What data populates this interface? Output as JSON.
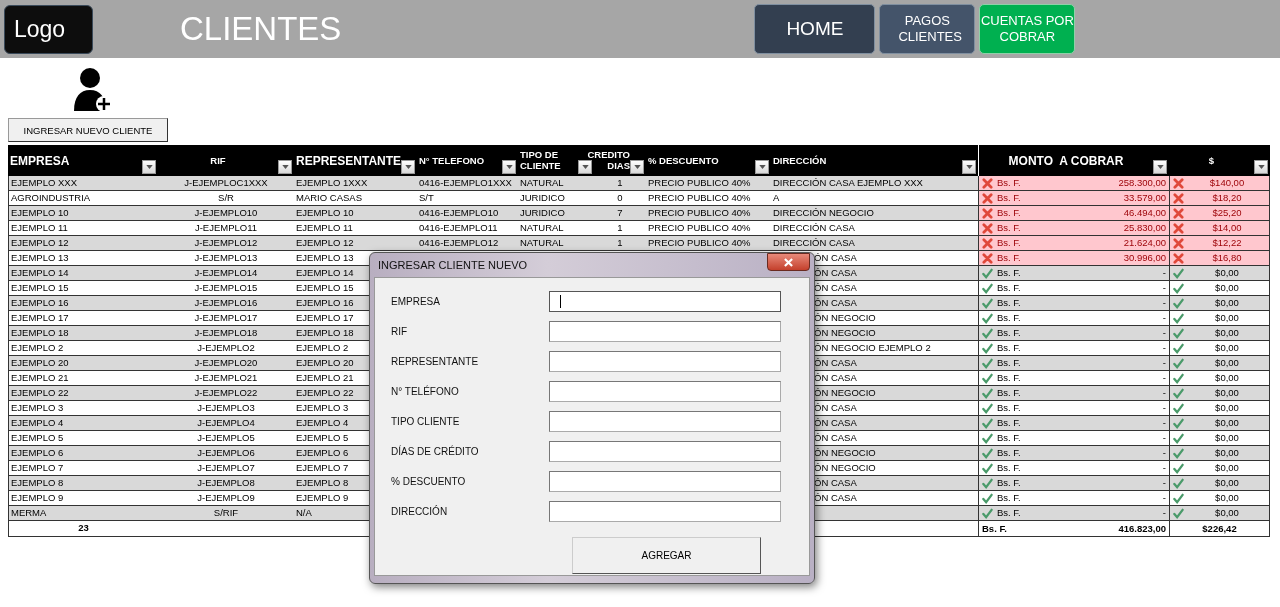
{
  "header": {
    "logo": "Logo",
    "title": "CLIENTES",
    "nav": [
      {
        "label": "HOME",
        "kind": "dark"
      },
      {
        "label": "PAGOS CLIENTES",
        "kind": "slate"
      },
      {
        "label": "CUENTAS POR COBRAR",
        "kind": "green"
      }
    ]
  },
  "new_client_button": "INGRESAR NUEVO CLIENTE",
  "table": {
    "columns": [
      {
        "label": "EMPRESA"
      },
      {
        "label": "RIF"
      },
      {
        "label": "REPRESENTANTE"
      },
      {
        "label": "N° TELEFONO"
      },
      {
        "label": "TIPO DE CLIENTE"
      },
      {
        "label": "CREDITO DIAS"
      },
      {
        "label": "% DESCUENTO"
      },
      {
        "label": "DIRECCIÓN"
      },
      {
        "label": "MONTO  A COBRAR"
      },
      {
        "label": "$"
      }
    ],
    "rows": [
      {
        "empresa": "EJEMPLO XXX",
        "rif": "J-EJEMPLOC1XXX",
        "representante": "EJEMPLO 1XXX",
        "telefono": "0416-EJEMPLO1XXX",
        "tipo": "NATURAL",
        "credito": "1",
        "descuento": "PRECIO PUBLICO 40%",
        "direccion": "DIRECCIÓN CASA EJEMPLO XXX",
        "covered": false,
        "pending": true,
        "currency": "Bs. F.",
        "monto": "258.300,00",
        "usd": "$140,00"
      },
      {
        "empresa": "AGROINDUSTRIA",
        "rif": "S/R",
        "representante": "MARIO CASAS",
        "telefono": "S/T",
        "tipo": "JURIDICO",
        "credito": "0",
        "descuento": "PRECIO PUBLICO 40%",
        "direccion": "A",
        "covered": false,
        "pending": true,
        "currency": "Bs. F.",
        "monto": "33.579,00",
        "usd": "$18,20"
      },
      {
        "empresa": "EJEMPLO 10",
        "rif": "J-EJEMPLO10",
        "representante": "EJEMPLO 10",
        "telefono": "0416-EJEMPLO10",
        "tipo": "JURIDICO",
        "credito": "7",
        "descuento": "PRECIO PUBLICO 40%",
        "direccion": "DIRECCIÓN NEGOCIO",
        "covered": false,
        "pending": true,
        "currency": "Bs. F.",
        "monto": "46.494,00",
        "usd": "$25,20"
      },
      {
        "empresa": "EJEMPLO 11",
        "rif": "J-EJEMPLO11",
        "representante": "EJEMPLO 11",
        "telefono": "0416-EJEMPLO11",
        "tipo": "NATURAL",
        "credito": "1",
        "descuento": "PRECIO PUBLICO 40%",
        "direccion": "DIRECCIÓN CASA",
        "covered": false,
        "pending": true,
        "currency": "Bs. F.",
        "monto": "25.830,00",
        "usd": "$14,00"
      },
      {
        "empresa": "EJEMPLO 12",
        "rif": "J-EJEMPLO12",
        "representante": "EJEMPLO 12",
        "telefono": "0416-EJEMPLO12",
        "tipo": "NATURAL",
        "credito": "1",
        "descuento": "PRECIO PUBLICO 40%",
        "direccion": "DIRECCIÓN CASA",
        "covered": false,
        "pending": true,
        "currency": "Bs. F.",
        "monto": "21.624,00",
        "usd": "$12,22"
      },
      {
        "empresa": "EJEMPLO 13",
        "rif": "J-EJEMPLO13",
        "representante": "EJEMPLO 13",
        "direccion": "ÓN CASA",
        "covered": true,
        "pending": true,
        "currency": "Bs. F.",
        "monto": "30.996,00",
        "usd": "$16,80"
      },
      {
        "empresa": "EJEMPLO 14",
        "rif": "J-EJEMPLO14",
        "representante": "EJEMPLO 14",
        "direccion": "ÓN CASA",
        "covered": true,
        "pending": false,
        "currency": "Bs. F.",
        "monto": "-",
        "usd": "$0,00"
      },
      {
        "empresa": "EJEMPLO 15",
        "rif": "J-EJEMPLO15",
        "representante": "EJEMPLO 15",
        "direccion": "ÓN CASA",
        "covered": true,
        "pending": false,
        "currency": "Bs. F.",
        "monto": "-",
        "usd": "$0,00"
      },
      {
        "empresa": "EJEMPLO 16",
        "rif": "J-EJEMPLO16",
        "representante": "EJEMPLO 16",
        "direccion": "ÓN CASA",
        "covered": true,
        "pending": false,
        "currency": "Bs. F.",
        "monto": "-",
        "usd": "$0,00"
      },
      {
        "empresa": "EJEMPLO 17",
        "rif": "J-EJEMPLO17",
        "representante": "EJEMPLO 17",
        "direccion": "ÓN NEGOCIO",
        "covered": true,
        "pending": false,
        "currency": "Bs. F.",
        "monto": "-",
        "usd": "$0,00"
      },
      {
        "empresa": "EJEMPLO 18",
        "rif": "J-EJEMPLO18",
        "representante": "EJEMPLO 18",
        "direccion": "ÓN NEGOCIO",
        "covered": true,
        "pending": false,
        "currency": "Bs. F.",
        "monto": "-",
        "usd": "$0,00"
      },
      {
        "empresa": "EJEMPLO 2",
        "rif": "J-EJEMPLO2",
        "representante": "EJEMPLO 2",
        "direccion": "ÓN NEGOCIO EJEMPLO 2",
        "covered": true,
        "pending": false,
        "currency": "Bs. F.",
        "monto": "-",
        "usd": "$0,00"
      },
      {
        "empresa": "EJEMPLO 20",
        "rif": "J-EJEMPLO20",
        "representante": "EJEMPLO 20",
        "direccion": "ÓN CASA",
        "covered": true,
        "pending": false,
        "currency": "Bs. F.",
        "monto": "-",
        "usd": "$0,00"
      },
      {
        "empresa": "EJEMPLO 21",
        "rif": "J-EJEMPLO21",
        "representante": "EJEMPLO 21",
        "direccion": "ÓN CASA",
        "covered": true,
        "pending": false,
        "currency": "Bs. F.",
        "monto": "-",
        "usd": "$0,00"
      },
      {
        "empresa": "EJEMPLO 22",
        "rif": "J-EJEMPLO22",
        "representante": "EJEMPLO 22",
        "direccion": "ÓN NEGOCIO",
        "covered": true,
        "pending": false,
        "currency": "Bs. F.",
        "monto": "-",
        "usd": "$0,00"
      },
      {
        "empresa": "EJEMPLO 3",
        "rif": "J-EJEMPLO3",
        "representante": "EJEMPLO 3",
        "direccion": "ÓN CASA",
        "covered": true,
        "pending": false,
        "currency": "Bs. F.",
        "monto": "-",
        "usd": "$0,00"
      },
      {
        "empresa": "EJEMPLO 4",
        "rif": "J-EJEMPLO4",
        "representante": "EJEMPLO 4",
        "direccion": "ÓN CASA",
        "covered": true,
        "pending": false,
        "currency": "Bs. F.",
        "monto": "-",
        "usd": "$0,00"
      },
      {
        "empresa": "EJEMPLO 5",
        "rif": "J-EJEMPLO5",
        "representante": "EJEMPLO 5",
        "direccion": "ÓN CASA",
        "covered": true,
        "pending": false,
        "currency": "Bs. F.",
        "monto": "-",
        "usd": "$0,00"
      },
      {
        "empresa": "EJEMPLO 6",
        "rif": "J-EJEMPLO6",
        "representante": "EJEMPLO 6",
        "direccion": "ÓN NEGOCIO",
        "covered": true,
        "pending": false,
        "currency": "Bs. F.",
        "monto": "-",
        "usd": "$0,00"
      },
      {
        "empresa": "EJEMPLO 7",
        "rif": "J-EJEMPLO7",
        "representante": "EJEMPLO 7",
        "direccion": "ÓN NEGOCIO",
        "covered": true,
        "pending": false,
        "currency": "Bs. F.",
        "monto": "-",
        "usd": "$0,00"
      },
      {
        "empresa": "EJEMPLO 8",
        "rif": "J-EJEMPLO8",
        "representante": "EJEMPLO 8",
        "direccion": "ÓN CASA",
        "covered": true,
        "pending": false,
        "currency": "Bs. F.",
        "monto": "-",
        "usd": "$0,00"
      },
      {
        "empresa": "EJEMPLO 9",
        "rif": "J-EJEMPLO9",
        "representante": "EJEMPLO 9",
        "direccion": "ÓN CASA",
        "covered": true,
        "pending": false,
        "currency": "Bs. F.",
        "monto": "-",
        "usd": "$0,00"
      },
      {
        "empresa": "MERMA",
        "rif": "S/RIF",
        "representante": "N/A",
        "pending": false,
        "currency": "Bs. F.",
        "monto": "-",
        "usd": "$0,00"
      }
    ],
    "totals": {
      "count": "23",
      "currency": "Bs. F.",
      "amount": "416.823,00",
      "usd": "$226,42"
    }
  },
  "dialog": {
    "title": "INGRESAR CLIENTE NUEVO",
    "fields": [
      {
        "label": "EMPRESA",
        "focused": true
      },
      {
        "label": "RIF",
        "focused": false
      },
      {
        "label": "REPRESENTANTE",
        "focused": false
      },
      {
        "label": "N° TELÉFONO",
        "focused": false
      },
      {
        "label": "TIPO CLIENTE",
        "focused": false
      },
      {
        "label": "DÍAS DE CRÉDITO",
        "focused": false
      },
      {
        "label": "% DESCUENTO",
        "focused": false
      },
      {
        "label": "DIRECCIÓN",
        "focused": false
      }
    ],
    "button": "AGREGAR"
  }
}
